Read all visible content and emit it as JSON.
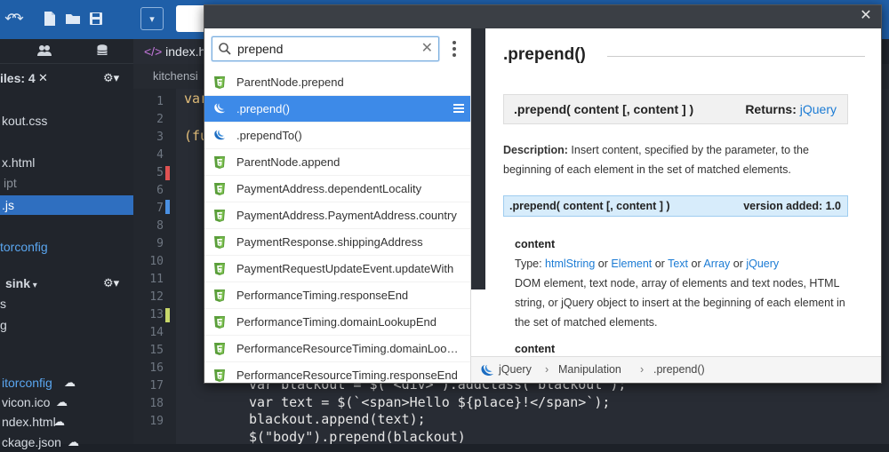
{
  "toolbar": {
    "icons": [
      "undo-icon",
      "redo-icon",
      "new-file-icon",
      "open-folder-icon",
      "save-icon",
      "dropdown-chevron-icon"
    ]
  },
  "sidebar": {
    "open_files_label": "iles: 4",
    "items": [
      {
        "label": "kout.css",
        "style": "link"
      },
      {
        "label": "x.html",
        "style": "normal"
      },
      {
        "label": "ipt",
        "style": "dim"
      },
      {
        "label": ".js",
        "style": "sel"
      },
      {
        "label": "torconfig",
        "style": "link"
      },
      {
        "label": "sink",
        "style": "header"
      },
      {
        "label": "s",
        "style": "normal"
      },
      {
        "label": "g",
        "style": "normal"
      },
      {
        "label": "itorconfig",
        "style": "link"
      },
      {
        "label": "vicon.ico",
        "style": "normal"
      },
      {
        "label": "ndex.html",
        "style": "normal"
      },
      {
        "label": "ckage.json",
        "style": "normal"
      }
    ]
  },
  "editor": {
    "tab_label": "index.ht",
    "crumb_label": "kitchensi",
    "line_numbers": [
      "1",
      "2",
      "3",
      "4",
      "5",
      "6",
      "7",
      "8",
      "9",
      "10",
      "11",
      "12",
      "13",
      "14",
      "15",
      "16",
      "17",
      "18",
      "19"
    ],
    "code_top_1": "var",
    "code_top_3": "(fu",
    "code_17": "var blackout = $('<div>').addClass('blackout');",
    "code_18": "var text = $(`<span>Hello ${place}!</span>`);",
    "code_19": "blackout.append(text);",
    "code_20": "$(\"body\").prepend(blackout)"
  },
  "popup": {
    "close_label": "✕",
    "search": {
      "value": "prepend",
      "placeholder": "Search"
    },
    "results": [
      {
        "label": "ParentNode.prepend",
        "icon": "html5-icon",
        "selected": false
      },
      {
        "label": ".prepend()",
        "icon": "jquery-icon",
        "selected": true
      },
      {
        "label": ".prependTo()",
        "icon": "jquery-icon",
        "selected": false
      },
      {
        "label": "ParentNode.append",
        "icon": "html5-icon",
        "selected": false
      },
      {
        "label": "PaymentAddress.dependentLocality",
        "icon": "html5-icon",
        "selected": false
      },
      {
        "label": "PaymentAddress.PaymentAddress.country",
        "icon": "html5-icon",
        "selected": false
      },
      {
        "label": "PaymentResponse.shippingAddress",
        "icon": "html5-icon",
        "selected": false
      },
      {
        "label": "PaymentRequestUpdateEvent.updateWith",
        "icon": "html5-icon",
        "selected": false
      },
      {
        "label": "PerformanceTiming.responseEnd",
        "icon": "html5-icon",
        "selected": false
      },
      {
        "label": "PerformanceTiming.domainLookupEnd",
        "icon": "html5-icon",
        "selected": false
      },
      {
        "label": "PerformanceResourceTiming.domainLoo…",
        "icon": "html5-icon",
        "selected": false
      },
      {
        "label": "PerformanceResourceTiming.responseEnd",
        "icon": "html5-icon",
        "selected": false
      }
    ],
    "doc": {
      "title": ".prepend()",
      "signature": ".prepend( content [, content ] )",
      "returns_label": "Returns:",
      "returns_type": "jQuery",
      "description_label": "Description:",
      "description_text": " Insert content, specified by the parameter, to the beginning of each element in the set of matched elements.",
      "version_signature": ".prepend( content [, content ] )",
      "version_added": "version added: 1.0",
      "param_name": "content",
      "param_type_label": "Type: ",
      "param_types": [
        "htmlString",
        "Element",
        "Text",
        "Array",
        "jQuery"
      ],
      "param_or": " or ",
      "param_desc": "DOM element, text node, array of elements and text nodes, HTML string, or jQuery object to insert at the beginning of each element in the set of matched elements.",
      "param2_name": "content"
    },
    "breadcrumb": [
      "jQuery",
      "Manipulation",
      ".prepend()"
    ],
    "breadcrumb_sep": "›"
  },
  "colors": {
    "accent": "#3d8ae8",
    "link": "#1b7bd4",
    "version_bg": "#d7ecfb",
    "toolbar": "#1f5fa8"
  }
}
